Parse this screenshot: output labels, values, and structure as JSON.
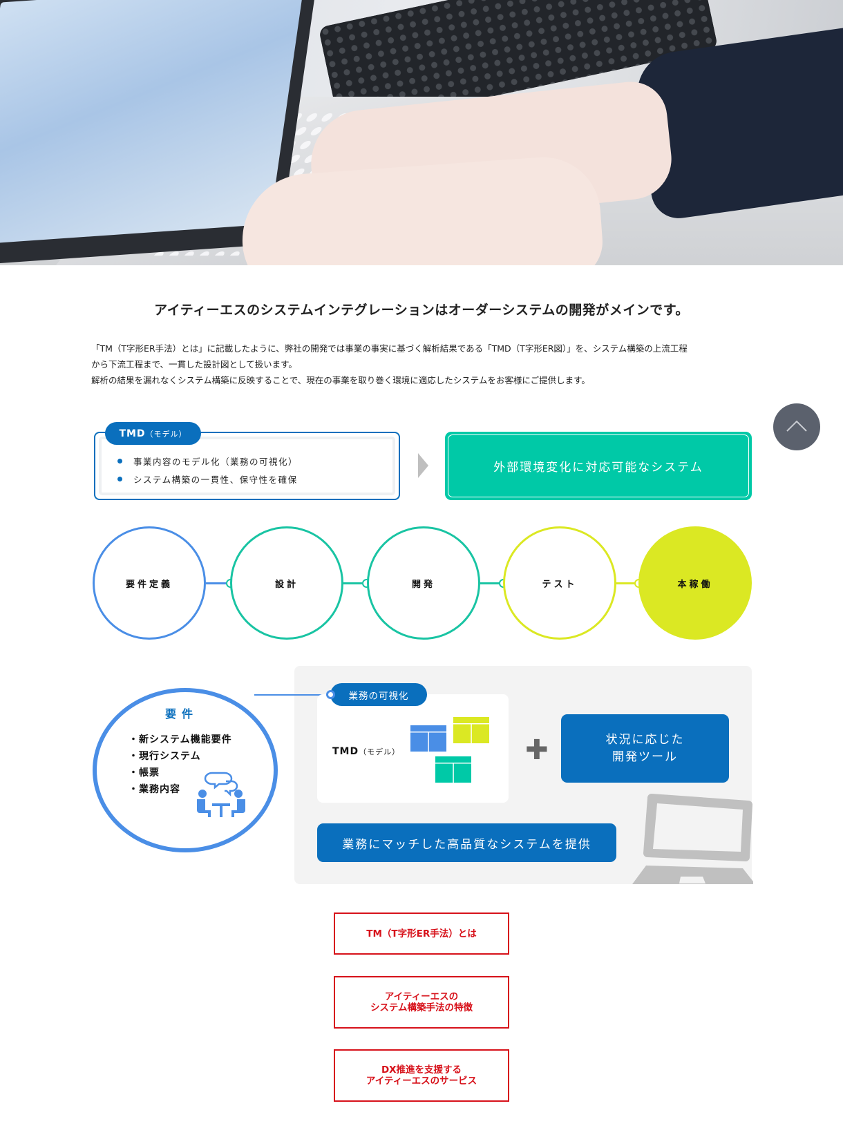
{
  "hero": {
    "image": "laptop-typing-photo"
  },
  "intro": {
    "headline": "アイティーエスのシステムインテグレーションはオーダーシステムの開発がメインです。",
    "paragraph_lines": [
      "「TM（T字形ER手法）とは」に記載したように、弊社の開発では事業の事実に基づく解析結果である「TMD（T字形ER図）」を、システム構築の上流工程",
      "から下流工程まで、一貫した設計図として扱います。",
      "解析の結果を漏れなくシステム構築に反映することで、現在の事業を取り巻く環境に適応したシステムをお客様にご提供します。"
    ]
  },
  "tmd_box": {
    "tag_main": "TMD",
    "tag_sub": "（モデル）",
    "items": [
      "事業内容のモデル化（業務の可視化）",
      "システム構築の一貫性、保守性を確保"
    ]
  },
  "result_box": {
    "label": "外部環境変化に対応可能なシステム"
  },
  "scroll_top": {
    "icon": "chevron-up-icon"
  },
  "process": {
    "steps": [
      {
        "label": "要件定義",
        "color": "#4a8ee6"
      },
      {
        "label": "設計",
        "color": "#19c4a3"
      },
      {
        "label": "開発",
        "color": "#19c4a3"
      },
      {
        "label": "テスト",
        "color": "#dbe823"
      },
      {
        "label": "本稼働",
        "color": "#dbe823",
        "filled": true
      }
    ]
  },
  "requirements": {
    "title": "要件",
    "items": [
      "・新システム機能要件",
      "・現行システム",
      "・帳票",
      "・業務内容"
    ],
    "icon": "meeting-icon"
  },
  "panel": {
    "model_tag": "業務の可視化",
    "model_label_main": "TMD",
    "model_label_sub": "（モデル）",
    "plus_symbol": "✚",
    "tool_box_lines": [
      "状況に応じた",
      "開発ツール"
    ],
    "deliver_label": "業務にマッチした高品質なシステムを提供",
    "icon": "laptop-icon"
  },
  "links": [
    {
      "label": "TM（T字形ER手法）とは"
    },
    {
      "label": "アイティーエスの\nシステム構築手法の特徴"
    },
    {
      "label": "DX推進を支援する\nアイティーエスのサービス"
    }
  ],
  "colors": {
    "brand_blue": "#0a6fbd",
    "light_blue": "#4a8ee6",
    "teal": "#00c9a7",
    "lime": "#dbe823",
    "link_red": "#d7111a",
    "panel_gray": "#f3f3f3"
  }
}
